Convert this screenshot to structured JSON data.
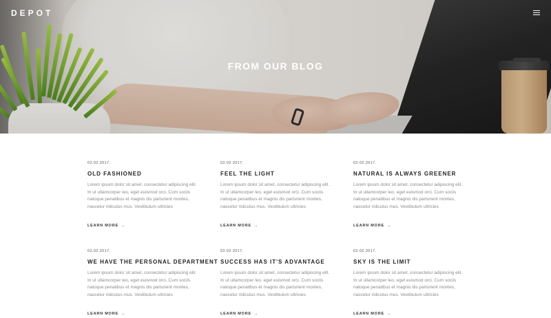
{
  "header": {
    "logo": "DEPOT",
    "menu_icon": "hamburger-menu-icon"
  },
  "hero": {
    "title": "FROM OUR BLOG"
  },
  "posts": [
    {
      "date": "02.02.2017.",
      "title": "OLD FASHIONED",
      "excerpt": "Lorem ipsum dolor sit amet, consectetur adipiscing elit. In ut ullamcorper leo, eget euismod orci. Cum sociis natoque penatibus et magnis dis parturient montes, nascetur ridiculus mus. Vestibulum ultricies",
      "read_more": "LEARN MORE"
    },
    {
      "date": "02.02.2017.",
      "title": "FEEL THE LIGHT",
      "excerpt": "Lorem ipsum dolor sit amet, consectetur adipiscing elit. In ut ullamcorper leo, eget euismod orci. Cum sociis natoque penatibus et magnis dis parturient montes, nascetur ridiculus mus. Vestibulum ultricies",
      "read_more": "LEARN MORE"
    },
    {
      "date": "02.02.2017.",
      "title": "NATURAL IS ALWAYS GREENER",
      "excerpt": "Lorem ipsum dolor sit amet, consectetur adipiscing elit. In ut ullamcorper leo, eget euismod orci. Cum sociis natoque penatibus et magnis dis parturient montes, nascetur ridiculus mus. Vestibulum ultricies",
      "read_more": "LEARN MORE"
    },
    {
      "date": "02.02.2017.",
      "title": "WE HAVE THE PERSONAL DEPARTMENT",
      "excerpt": "Lorem ipsum dolor sit amet, consectetur adipiscing elit. In ut ullamcorper leo, eget euismod orci. Cum sociis natoque penatibus et magnis dis parturient montes, nascetur ridiculus mus. Vestibulum ultricies",
      "read_more": "LEARN MORE"
    },
    {
      "date": "02.02.2017.",
      "title": "SUCCESS HAS IT'S ADVANTAGE",
      "excerpt": "Lorem ipsum dolor sit amet, consectetur adipiscing elit. In ut ullamcorper leo, eget euismod orci. Cum sociis natoque penatibus et magnis dis parturient montes, nascetur ridiculus mus. Vestibulum ultricies",
      "read_more": "LEARN MORE"
    },
    {
      "date": "02.02.2017.",
      "title": "SKY IS THE LIMIT",
      "excerpt": "Lorem ipsum dolor sit amet, consectetur adipiscing elit. In ut ullamcorper leo, eget euismod orci. Cum sociis natoque penatibus et magnis dis parturient montes, nascetur ridiculus mus. Vestibulum ultricies",
      "read_more": "LEARN MORE"
    }
  ],
  "colors": {
    "hero_text": "#ffffff",
    "title_text": "#222222",
    "body_text": "#8a8a8a"
  }
}
